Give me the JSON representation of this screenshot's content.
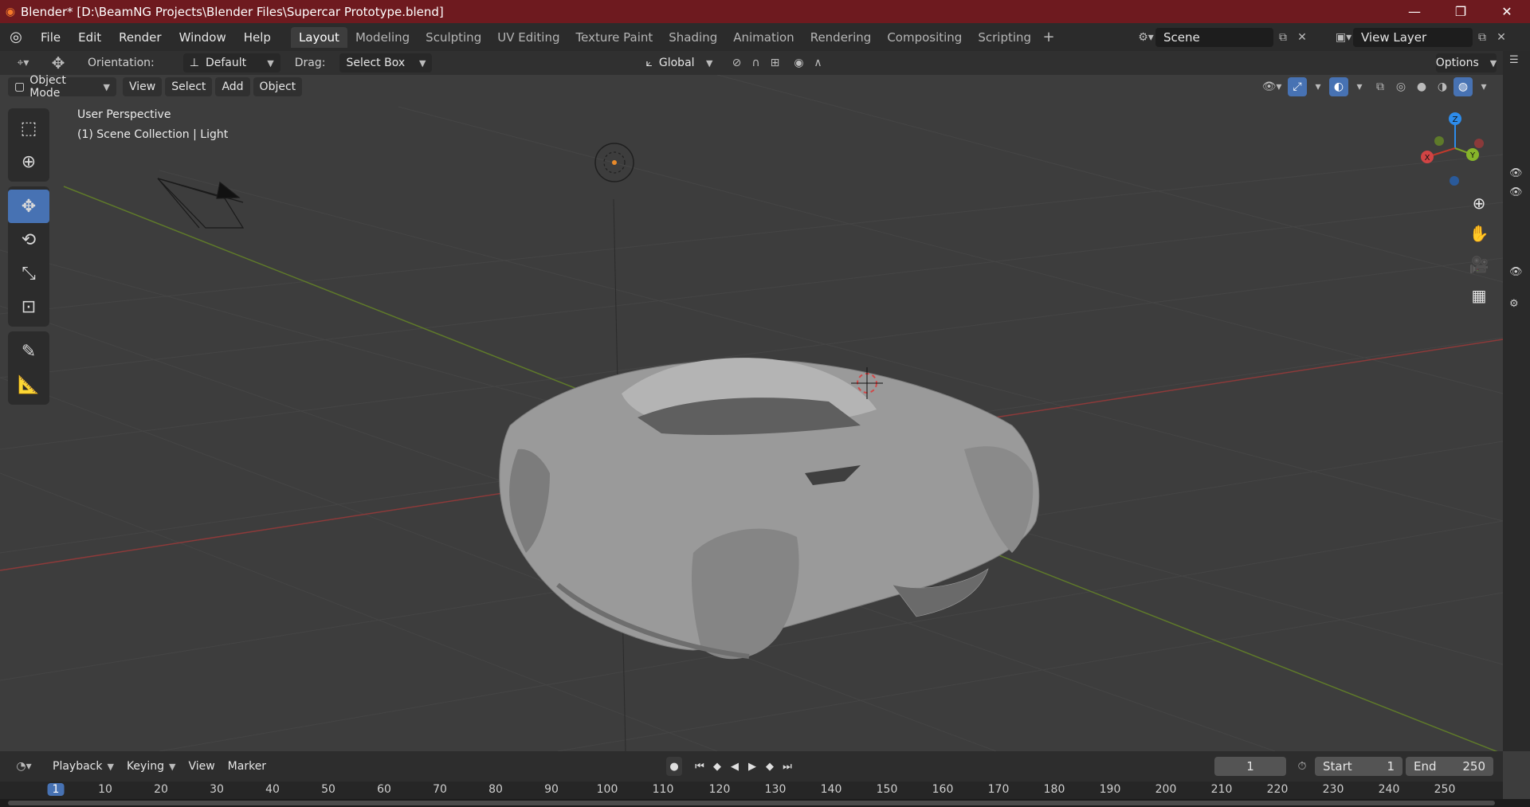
{
  "window": {
    "title": "Blender* [D:\\BeamNG Projects\\Blender Files\\Supercar Prototype.blend]",
    "controls": [
      "—",
      "❐",
      "✕"
    ]
  },
  "menu": [
    "File",
    "Edit",
    "Render",
    "Window",
    "Help"
  ],
  "workspaces": [
    "Layout",
    "Modeling",
    "Sculpting",
    "UV Editing",
    "Texture Paint",
    "Shading",
    "Animation",
    "Rendering",
    "Compositing",
    "Scripting"
  ],
  "scene": {
    "name": "Scene"
  },
  "view_layer": {
    "name": "View Layer"
  },
  "tool_settings": {
    "orientation_label": "Orientation:",
    "orientation_value": "Default",
    "drag_label": "Drag:",
    "drag_value": "Select Box",
    "transform_orientation": "Global",
    "options_label": "Options"
  },
  "viewport_header": {
    "mode": "Object Mode",
    "menus": [
      "View",
      "Select",
      "Add",
      "Object"
    ]
  },
  "viewport": {
    "perspective": "User Perspective",
    "collection": "(1) Scene Collection | Light",
    "gizmo": {
      "x": "X",
      "y": "Y",
      "z": "Z"
    }
  },
  "timeline": {
    "menus": [
      "Playback",
      "Keying",
      "View",
      "Marker"
    ],
    "current_frame": "1",
    "start_label": "Start",
    "start_value": "1",
    "end_label": "End",
    "end_value": "250",
    "ruler": [
      "1",
      "10",
      "20",
      "30",
      "40",
      "50",
      "60",
      "70",
      "80",
      "90",
      "100",
      "110",
      "120",
      "130",
      "140",
      "150",
      "160",
      "170",
      "180",
      "190",
      "200",
      "210",
      "220",
      "230",
      "240",
      "250"
    ]
  },
  "colors": {
    "accent": "#4772b3",
    "titlebar": "#6e1a1f",
    "x_axis": "#c0392b",
    "y_axis": "#7fa52a",
    "z_axis": "#2d8ceb"
  }
}
